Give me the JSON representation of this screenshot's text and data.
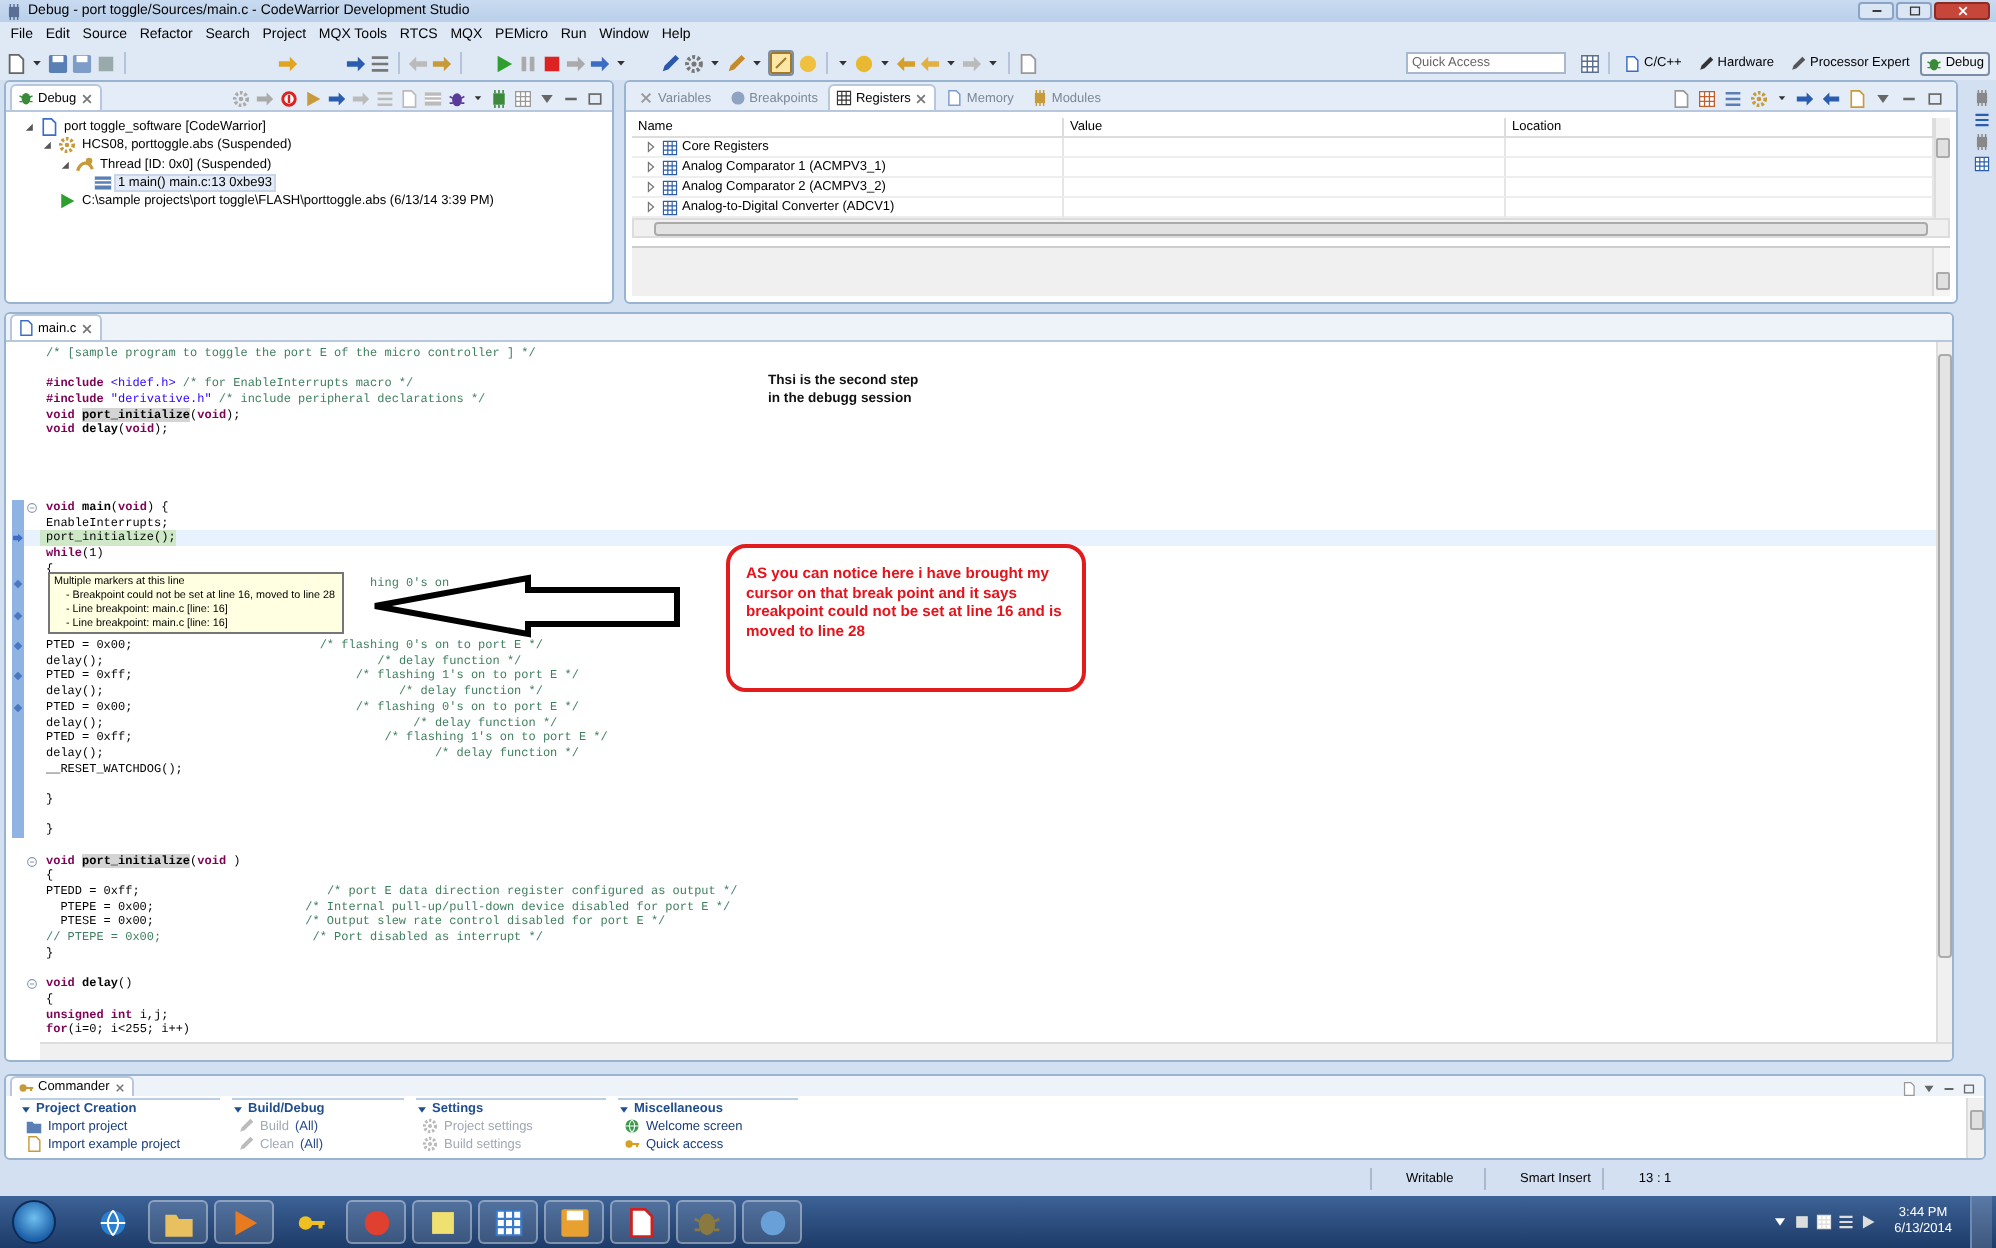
{
  "window": {
    "title": "Debug - port toggle/Sources/main.c - CodeWarrior Development Studio"
  },
  "menus": [
    "File",
    "Edit",
    "Source",
    "Refactor",
    "Search",
    "Project",
    "MQX Tools",
    "RTCS",
    "MQX",
    "PEMicro",
    "Run",
    "Window",
    "Help"
  ],
  "quick_access": {
    "placeholder": "Quick Access"
  },
  "perspectives": [
    {
      "label": "C/C++",
      "kind": "cpp",
      "selected": false
    },
    {
      "label": "Hardware",
      "kind": "hardware",
      "selected": false
    },
    {
      "label": "Processor Expert",
      "kind": "expert",
      "selected": false
    },
    {
      "label": "Debug",
      "kind": "debug",
      "selected": true
    }
  ],
  "debug_view": {
    "tab": {
      "label": "Debug",
      "selected": true
    },
    "tree": [
      {
        "label": "port toggle_software [CodeWarrior]",
        "kind": "project",
        "expanded": true,
        "selected": false,
        "children": [
          {
            "label": "HCS08, porttoggle.abs (Suspended)",
            "kind": "target",
            "expanded": true,
            "selected": false,
            "children": [
              {
                "label": "Thread [ID: 0x0] (Suspended)",
                "kind": "thread",
                "expanded": true,
                "selected": false,
                "children": [
                  {
                    "label": "1 main() main.c:13 0xbe93",
                    "kind": "frame",
                    "selected": true
                  }
                ]
              }
            ]
          },
          {
            "label": "C:\\sample projects\\port toggle\\FLASH\\porttoggle.abs (6/13/14 3:39 PM)",
            "kind": "file",
            "selected": false
          }
        ]
      }
    ]
  },
  "registers_view": {
    "tabs": [
      {
        "label": "Variables",
        "kind": "variables",
        "selected": false
      },
      {
        "label": "Breakpoints",
        "kind": "breakpoints",
        "selected": false
      },
      {
        "label": "Registers",
        "kind": "registers",
        "selected": true
      },
      {
        "label": "Memory",
        "kind": "memory",
        "selected": false
      },
      {
        "label": "Modules",
        "kind": "modules",
        "selected": false
      }
    ],
    "columns": [
      "Name",
      "Value",
      "Location"
    ],
    "rows": [
      {
        "label": "Core Registers",
        "expanded": false
      },
      {
        "label": "Analog Comparator 1 (ACMPV3_1)",
        "expanded": false
      },
      {
        "label": "Analog Comparator 2 (ACMPV3_2)",
        "expanded": false
      },
      {
        "label": "Analog-to-Digital Converter (ADCV1)",
        "expanded": false
      }
    ]
  },
  "editor": {
    "tabs": [
      {
        "label": "main.c",
        "selected": true
      }
    ],
    "lines": [
      {
        "in_scope": false,
        "segments": [
          {
            "kind": "cm",
            "text": "/* [sample program to toggle the port E of the micro controller ] */"
          }
        ]
      },
      {
        "in_scope": false
      },
      {
        "in_scope": false,
        "segments": [
          {
            "kind": "kw",
            "text": "#include "
          },
          {
            "kind": "str",
            "text": "<hidef.h>"
          },
          {
            "kind": "cm",
            "text": " /* for EnableInterrupts macro */"
          }
        ]
      },
      {
        "in_scope": false,
        "segments": [
          {
            "kind": "kw",
            "text": "#include "
          },
          {
            "kind": "str",
            "text": "\"derivative.h\""
          },
          {
            "kind": "cm",
            "text": " /* include peripheral declarations */"
          }
        ]
      },
      {
        "in_scope": false,
        "segments": [
          {
            "kind": "kw",
            "text": "void "
          },
          {
            "kind": "occ",
            "text": "port_initialize"
          },
          {
            "kind": "tx",
            "text": "("
          },
          {
            "kind": "kw",
            "text": "void"
          },
          {
            "kind": "tx",
            "text": ");"
          }
        ]
      },
      {
        "in_scope": false,
        "segments": [
          {
            "kind": "kw",
            "text": "void "
          },
          {
            "kind": "fn",
            "text": "delay"
          },
          {
            "kind": "tx",
            "text": "("
          },
          {
            "kind": "kw",
            "text": "void"
          },
          {
            "kind": "tx",
            "text": ");"
          }
        ]
      },
      {
        "in_scope": false
      },
      {
        "in_scope": false
      },
      {
        "in_scope": false
      },
      {
        "in_scope": false
      },
      {
        "in_scope": true,
        "kind": "fold",
        "segments": [
          {
            "kind": "kw",
            "text": "void "
          },
          {
            "kind": "fn",
            "text": "main"
          },
          {
            "kind": "tx",
            "text": "("
          },
          {
            "kind": "kw",
            "text": "void"
          },
          {
            "kind": "tx",
            "text": ") {"
          }
        ]
      },
      {
        "in_scope": true,
        "segments": [
          {
            "kind": "tx",
            "text": "EnableInterrupts;"
          }
        ]
      },
      {
        "in_scope": true,
        "kind": "current",
        "segments": [
          {
            "kind": "tx",
            "text": "port_initialize();"
          }
        ]
      },
      {
        "in_scope": true,
        "segments": [
          {
            "kind": "kw",
            "text": "while"
          },
          {
            "kind": "tx",
            "text": "(1)"
          }
        ]
      },
      {
        "in_scope": true,
        "segments": [
          {
            "kind": "tx",
            "text": "{"
          }
        ]
      },
      {
        "in_scope": true,
        "kind": "covered_breakpoint",
        "segments": [
          {
            "kind": "cm",
            "text": "hing 0's on"
          }
        ]
      },
      {
        "in_scope": true
      },
      {
        "in_scope": true,
        "kind": "breakpoint"
      },
      {
        "in_scope": true
      },
      {
        "in_scope": true,
        "kind": "breakpoint",
        "segments": [
          {
            "kind": "tx",
            "text": "PTED = 0x00;                          "
          },
          {
            "kind": "cm",
            "text": "/* flashing 0's on to port E */"
          }
        ]
      },
      {
        "in_scope": true,
        "segments": [
          {
            "kind": "tx",
            "text": "delay();                                      "
          },
          {
            "kind": "cm",
            "text": "/* delay function */"
          }
        ]
      },
      {
        "in_scope": true,
        "kind": "breakpoint",
        "segments": [
          {
            "kind": "tx",
            "text": "PTED = 0xff;                               "
          },
          {
            "kind": "cm",
            "text": "/* flashing 1's on to port E */"
          }
        ]
      },
      {
        "in_scope": true,
        "segments": [
          {
            "kind": "tx",
            "text": "delay();                                         "
          },
          {
            "kind": "cm",
            "text": "/* delay function */"
          }
        ]
      },
      {
        "in_scope": true,
        "kind": "breakpoint",
        "segments": [
          {
            "kind": "tx",
            "text": "PTED = 0x00;                               "
          },
          {
            "kind": "cm",
            "text": "/* flashing 0's on to port E */"
          }
        ]
      },
      {
        "in_scope": true,
        "segments": [
          {
            "kind": "tx",
            "text": "delay();                                           "
          },
          {
            "kind": "cm",
            "text": "/* delay function */"
          }
        ]
      },
      {
        "in_scope": true,
        "segments": [
          {
            "kind": "tx",
            "text": "PTED = 0xff;                                   "
          },
          {
            "kind": "cm",
            "text": "/* flashing 1's on to port E */"
          }
        ]
      },
      {
        "in_scope": true,
        "segments": [
          {
            "kind": "tx",
            "text": "delay();                                              "
          },
          {
            "kind": "cm",
            "text": "/* delay function */"
          }
        ]
      },
      {
        "in_scope": true,
        "segments": [
          {
            "kind": "tx",
            "text": "__RESET_WATCHDOG();"
          }
        ]
      },
      {
        "in_scope": true
      },
      {
        "in_scope": true,
        "segments": [
          {
            "kind": "tx",
            "text": "}"
          }
        ]
      },
      {
        "in_scope": true
      },
      {
        "in_scope": true,
        "segments": [
          {
            "kind": "tx",
            "text": "}"
          }
        ]
      },
      {
        "in_scope": false
      },
      {
        "in_scope": false,
        "kind": "fold",
        "segments": [
          {
            "kind": "kw",
            "text": "void "
          },
          {
            "kind": "occ",
            "text": "port_initialize"
          },
          {
            "kind": "tx",
            "text": "("
          },
          {
            "kind": "kw",
            "text": "void"
          },
          {
            "kind": "tx",
            "text": " )"
          }
        ]
      },
      {
        "in_scope": false,
        "segments": [
          {
            "kind": "tx",
            "text": "{"
          }
        ]
      },
      {
        "in_scope": false,
        "segments": [
          {
            "kind": "tx",
            "text": "PTEDD = 0xff;                          "
          },
          {
            "kind": "cm",
            "text": "/* port E data direction register configured as output */"
          }
        ]
      },
      {
        "in_scope": false,
        "segments": [
          {
            "kind": "tx",
            "text": "  PTEPE = 0x00;                     "
          },
          {
            "kind": "cm",
            "text": "/* Internal pull-up/pull-down device disabled for port E */"
          }
        ]
      },
      {
        "in_scope": false,
        "segments": [
          {
            "kind": "tx",
            "text": "  PTESE = 0x00;                     "
          },
          {
            "kind": "cm",
            "text": "/* Output slew rate control disabled for port E */"
          }
        ]
      },
      {
        "in_scope": false,
        "segments": [
          {
            "kind": "cm",
            "text": "// PTEPE = 0x00;                     /* Port disabled as interrupt */"
          }
        ]
      },
      {
        "in_scope": false,
        "segments": [
          {
            "kind": "tx",
            "text": "}"
          }
        ]
      },
      {
        "in_scope": false
      },
      {
        "in_scope": false,
        "kind": "fold",
        "segments": [
          {
            "kind": "kw",
            "text": "void "
          },
          {
            "kind": "fn",
            "text": "delay"
          },
          {
            "kind": "tx",
            "text": "()"
          }
        ]
      },
      {
        "in_scope": false,
        "segments": [
          {
            "kind": "tx",
            "text": "{"
          }
        ]
      },
      {
        "in_scope": false,
        "segments": [
          {
            "kind": "kw",
            "text": "unsigned int "
          },
          {
            "kind": "tx",
            "text": "i,j;"
          }
        ]
      },
      {
        "in_scope": false,
        "segments": [
          {
            "kind": "kw",
            "text": "for"
          },
          {
            "kind": "tx",
            "text": "(i=0; i<255; i++)"
          }
        ]
      }
    ],
    "tooltip": {
      "title": "Multiple markers at this line",
      "items": [
        "- Breakpoint could not be set at line 16, moved to line 28",
        "- Line breakpoint: main.c [line: 16]",
        "- Line breakpoint: main.c [line: 16]"
      ]
    },
    "notes": [
      {
        "kind": "plain",
        "text": "Thsi is the second step\nin the debugg session"
      },
      {
        "kind": "callout",
        "text": "AS you can notice here i have brought my cursor on that break point and it says breakpoint could not be set at line 16 and is moved to line 28"
      }
    ]
  },
  "commander": {
    "tab": {
      "label": "Commander",
      "selected": true
    },
    "sections": [
      {
        "title": "Project Creation",
        "expanded": true,
        "items": [
          {
            "label": "Import project",
            "kind": "import",
            "disabled": false
          },
          {
            "label": "Import example project",
            "kind": "example",
            "disabled": false
          }
        ]
      },
      {
        "title": "Build/Debug",
        "expanded": true,
        "items": [
          {
            "label": "Build",
            "suffix": "(All)",
            "kind": "build",
            "disabled": true
          },
          {
            "label": "Clean",
            "suffix": "(All)",
            "kind": "clean",
            "disabled": true
          }
        ]
      },
      {
        "title": "Settings",
        "expanded": true,
        "items": [
          {
            "label": "Project settings",
            "kind": "settings",
            "disabled": true
          },
          {
            "label": "Build settings",
            "kind": "settings",
            "disabled": true
          }
        ]
      },
      {
        "title": "Miscellaneous",
        "expanded": true,
        "items": [
          {
            "label": "Welcome screen",
            "kind": "welcome",
            "disabled": false
          },
          {
            "label": "Quick access",
            "kind": "quick",
            "disabled": false
          }
        ]
      }
    ]
  },
  "status_bar": [
    "Writable",
    "Smart Insert",
    "13 : 1"
  ],
  "taskbar": {
    "time": "3:44 PM",
    "date": "6/13/2014"
  }
}
